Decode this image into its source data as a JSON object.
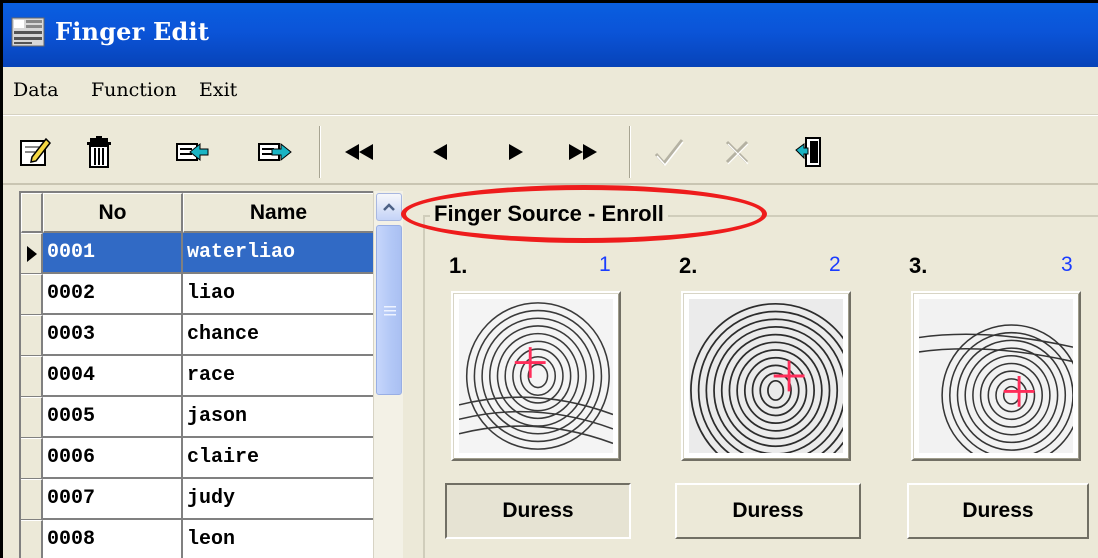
{
  "window": {
    "title": "Finger Edit",
    "title_icon": "app-icon",
    "accent": "#0b54d8"
  },
  "menu": {
    "items": [
      "Data",
      "Function",
      "Exit"
    ]
  },
  "toolbar": {
    "buttons": [
      {
        "name": "edit-icon"
      },
      {
        "name": "delete-icon"
      },
      {
        "name": "import-icon"
      },
      {
        "name": "export-icon"
      },
      {
        "name": "first-record-icon"
      },
      {
        "name": "prior-record-icon"
      },
      {
        "name": "next-record-icon"
      },
      {
        "name": "last-record-icon"
      },
      {
        "name": "post-check-icon",
        "disabled": true
      },
      {
        "name": "cancel-icon",
        "disabled": true
      },
      {
        "name": "exit-door-icon"
      }
    ]
  },
  "grid": {
    "columns": [
      "No",
      "Name"
    ],
    "rows": [
      {
        "no": "0001",
        "name": "waterliao",
        "selected": true
      },
      {
        "no": "0002",
        "name": "liao"
      },
      {
        "no": "0003",
        "name": "chance"
      },
      {
        "no": "0004",
        "name": "race"
      },
      {
        "no": "0005",
        "name": "jason"
      },
      {
        "no": "0006",
        "name": "claire"
      },
      {
        "no": "0007",
        "name": "judy"
      },
      {
        "no": "0008",
        "name": "leon"
      }
    ],
    "selection_color": "#316ac5"
  },
  "finger_panel": {
    "title": "Finger Source - Enroll",
    "slots": [
      {
        "label": "1.",
        "index": "1",
        "duress": "Duress"
      },
      {
        "label": "2.",
        "index": "2",
        "duress": "Duress"
      },
      {
        "label": "3.",
        "index": "3",
        "duress": "Duress"
      }
    ],
    "highlight_color": "#ee1c1c"
  }
}
